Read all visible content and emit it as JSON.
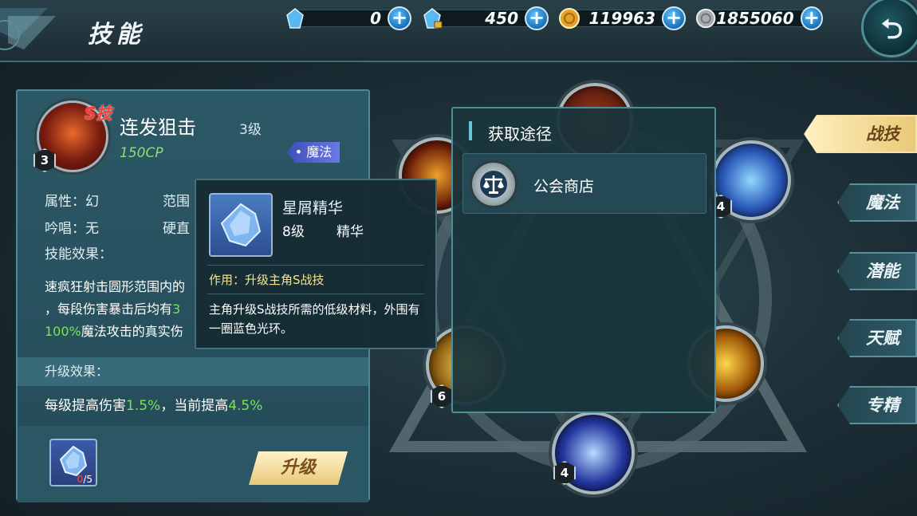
{
  "header": {
    "title": "技能",
    "resources": [
      {
        "name": "crystal",
        "value": "0",
        "color": "#5ab8f0"
      },
      {
        "name": "bound-crystal",
        "value": "450",
        "color": "#5ab8f0"
      },
      {
        "name": "gold",
        "value": "119963",
        "color": "#e3a02a"
      },
      {
        "name": "silver",
        "value": "1855060",
        "color": "#b8bcc0"
      }
    ],
    "plus_symbol": "+",
    "back_symbol": "⮌"
  },
  "skill": {
    "badge": "S技",
    "level_badge": "3",
    "name": "连发狙击",
    "level": "3级",
    "cp": "150CP",
    "tag": "魔法",
    "attr_attribute": "属性：幻",
    "attr_range": "范围",
    "attr_chant": "吟唱：无",
    "attr_stiff": "硬直",
    "effect_label": "技能效果：",
    "effect_line1": "速疯狂射击圆形范围内的",
    "effect_line2": "，每段伤害暴击后均有",
    "effect_line2_colored": "3",
    "effect_line3_green": "100%",
    "effect_line3": "魔法攻击的真实伤",
    "upgrade_label": "升级效果：",
    "upgrade_text1": "每级提高伤害",
    "upgrade_val1": "1.5%",
    "upgrade_text2": "，当前提高",
    "upgrade_val2": "4.5%",
    "material_have": "0",
    "material_need": "/5",
    "upgrade_button": "升级"
  },
  "tooltip": {
    "name": "星屑精华",
    "level": "8级",
    "type": "精华",
    "use": "作用：升级主角S战技",
    "desc": "主角升级S战技所需的低级材料，外围有一圈蓝色光环。"
  },
  "acquire": {
    "title": "获取途径",
    "items": [
      {
        "label": "公会商店"
      }
    ]
  },
  "ring": {
    "node_levels": [
      "4",
      "6",
      "4"
    ]
  },
  "tabs": [
    {
      "label": "战技",
      "active": true
    },
    {
      "label": "魔法",
      "active": false
    },
    {
      "label": "潜能",
      "active": false
    },
    {
      "label": "天赋",
      "active": false
    },
    {
      "label": "专精",
      "active": false
    }
  ]
}
